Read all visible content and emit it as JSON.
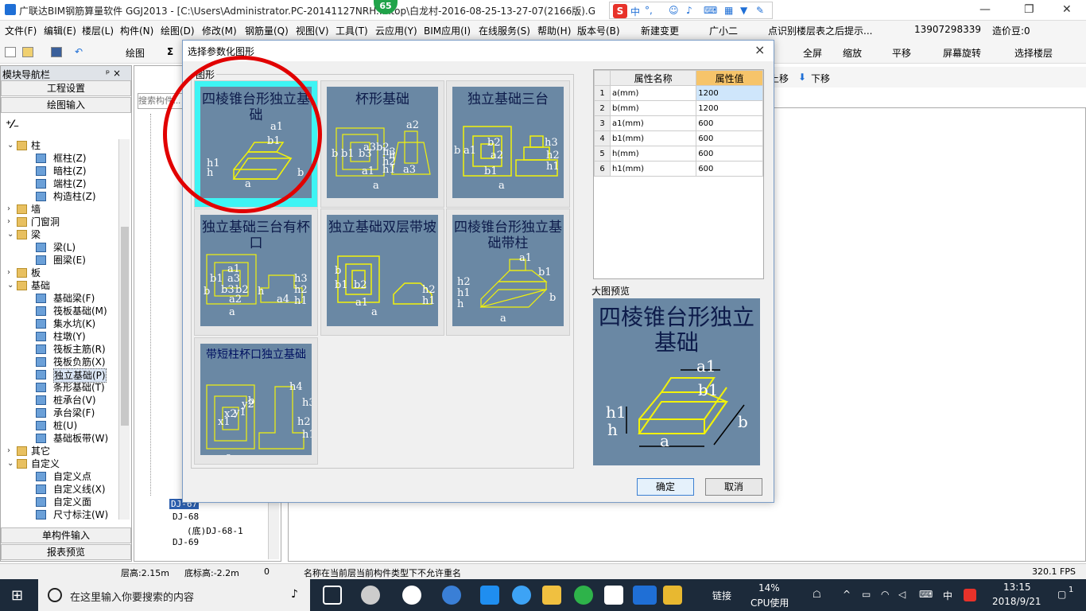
{
  "titlebar": {
    "badge": "65",
    "title": "广联达BIM钢筋算量软件 GGJ2013 - [C:\\Users\\Administrator.PC-20141127NRH...ktop\\白龙村-2016-08-25-13-27-07(2166版).G",
    "ime": {
      "lang": "中",
      "punct": "°,"
    }
  },
  "menubar": [
    "文件(F)",
    "编辑(E)",
    "楼层(L)",
    "构件(N)",
    "绘图(D)",
    "修改(M)",
    "钢筋量(Q)",
    "视图(V)",
    "工具(T)",
    "云应用(Y)",
    "BIM应用(I)",
    "在线服务(S)",
    "帮助(H)",
    "版本号(B)",
    "新建变更",
    "广小二",
    "点识别楼层表之后提示...",
    "13907298339",
    "造价豆:0"
  ],
  "toolbar": {
    "draw": "绘图",
    "sum": "Σ",
    "fullscreen": "全屏",
    "zoom": "缩放",
    "pan": "平移",
    "rotate": "屏幕旋转",
    "select_floor": "选择楼层",
    "new": "新建",
    "move_up": "上移",
    "move_down": "下移"
  },
  "left_panel": {
    "title": "模块导航栏",
    "pin": "ᵖ ×",
    "engineering_settings": "工程设置",
    "drawing_input": "绘图输入",
    "single_input": "单构件输入",
    "report_preview": "报表预览",
    "tree": [
      {
        "label": "柱",
        "level": 0,
        "type": "folder",
        "toggle": "⌄"
      },
      {
        "label": "框柱(Z)",
        "level": 1,
        "type": "comp"
      },
      {
        "label": "暗柱(Z)",
        "level": 1,
        "type": "comp"
      },
      {
        "label": "端柱(Z)",
        "level": 1,
        "type": "comp"
      },
      {
        "label": "构造柱(Z)",
        "level": 1,
        "type": "comp"
      },
      {
        "label": "墙",
        "level": 0,
        "type": "folder",
        "toggle": "›"
      },
      {
        "label": "门窗洞",
        "level": 0,
        "type": "folder",
        "toggle": "›"
      },
      {
        "label": "梁",
        "level": 0,
        "type": "folder",
        "toggle": "⌄"
      },
      {
        "label": "梁(L)",
        "level": 1,
        "type": "comp"
      },
      {
        "label": "圈梁(E)",
        "level": 1,
        "type": "comp"
      },
      {
        "label": "板",
        "level": 0,
        "type": "folder",
        "toggle": "›"
      },
      {
        "label": "基础",
        "level": 0,
        "type": "folder",
        "toggle": "⌄"
      },
      {
        "label": "基础梁(F)",
        "level": 1,
        "type": "comp"
      },
      {
        "label": "筏板基础(M)",
        "level": 1,
        "type": "comp"
      },
      {
        "label": "集水坑(K)",
        "level": 1,
        "type": "comp"
      },
      {
        "label": "柱墩(Y)",
        "level": 1,
        "type": "comp"
      },
      {
        "label": "筏板主筋(R)",
        "level": 1,
        "type": "comp"
      },
      {
        "label": "筏板负筋(X)",
        "level": 1,
        "type": "comp"
      },
      {
        "label": "独立基础(P)",
        "level": 1,
        "type": "comp",
        "selected": true
      },
      {
        "label": "条形基础(T)",
        "level": 1,
        "type": "comp"
      },
      {
        "label": "桩承台(V)",
        "level": 1,
        "type": "comp"
      },
      {
        "label": "承台梁(F)",
        "level": 1,
        "type": "comp"
      },
      {
        "label": "桩(U)",
        "level": 1,
        "type": "comp"
      },
      {
        "label": "基础板带(W)",
        "level": 1,
        "type": "comp"
      },
      {
        "label": "其它",
        "level": 0,
        "type": "folder",
        "toggle": "›"
      },
      {
        "label": "自定义",
        "level": 0,
        "type": "folder",
        "toggle": "⌄"
      },
      {
        "label": "自定义点",
        "level": 1,
        "type": "comp"
      },
      {
        "label": "自定义线(X)",
        "level": 1,
        "type": "comp"
      },
      {
        "label": "自定义面",
        "level": 1,
        "type": "comp"
      },
      {
        "label": "尺寸标注(W)",
        "level": 1,
        "type": "comp"
      }
    ]
  },
  "mid_panel": {
    "search_placeholder": "搜索构件...",
    "items": [
      "DJ-67",
      "DJ-68",
      "(底)DJ-68-1",
      "DJ-69"
    ]
  },
  "dialog": {
    "title": "选择参数化图形",
    "close": "×",
    "group_label": "图形",
    "shapes": [
      {
        "caption": "四棱锥台形独立基础",
        "dims": [
          "a1",
          "b1",
          "h1",
          "h",
          "a",
          "b"
        ],
        "selected": true
      },
      {
        "caption": "杯形基础",
        "dims": [
          "a2",
          "a3",
          "b3",
          "b2",
          "h3",
          "h2",
          "h1",
          "h",
          "a1",
          "a3",
          "b",
          "b1",
          "a"
        ]
      },
      {
        "caption": "独立基础三台",
        "dims": [
          "b2",
          "a2",
          "a1",
          "b1",
          "h3",
          "h2",
          "h1",
          "a",
          "b"
        ]
      },
      {
        "caption": "独立基础三台有杯口",
        "dims": [
          "a1",
          "a3",
          "b1",
          "b3",
          "b2",
          "a2",
          "h3",
          "h2",
          "h1",
          "a4",
          "a",
          "b",
          "h"
        ]
      },
      {
        "caption": "独立基础双层带坡",
        "dims": [
          "b1",
          "b2",
          "a1",
          "h2",
          "h1",
          "a",
          "b"
        ]
      },
      {
        "caption": "四棱锥台形独立基础带柱",
        "dims": [
          "a1",
          "b1",
          "h2",
          "h1",
          "h",
          "b",
          "a"
        ]
      },
      {
        "caption": "带短柱杯口独立基础",
        "dims": [
          "h4",
          "h3",
          "h2",
          "h1",
          "x1",
          "x2",
          "y1",
          "y2",
          "b",
          "a"
        ]
      }
    ],
    "properties": {
      "col_name": "属性名称",
      "col_value": "属性值",
      "rows": [
        {
          "idx": "1",
          "name": "a(mm)",
          "value": "1200"
        },
        {
          "idx": "2",
          "name": "b(mm)",
          "value": "1200"
        },
        {
          "idx": "3",
          "name": "a1(mm)",
          "value": "600"
        },
        {
          "idx": "4",
          "name": "b1(mm)",
          "value": "600"
        },
        {
          "idx": "5",
          "name": "h(mm)",
          "value": "600"
        },
        {
          "idx": "6",
          "name": "h1(mm)",
          "value": "600"
        }
      ]
    },
    "preview_label": "大图预览",
    "preview_caption": "四棱锥台形独立基础",
    "preview_dims": [
      "a1",
      "b1",
      "h1",
      "h",
      "a",
      "b"
    ],
    "ok": "确定",
    "cancel": "取消"
  },
  "statusbar": {
    "floor_height": "层高:2.15m",
    "bottom_elev": "底标高:-2.2m",
    "zero": "0",
    "message": "名称在当前层当前构件类型下不允许重名",
    "fps": "320.1 FPS"
  },
  "taskbar": {
    "search_placeholder": "在这里输入你要搜索的内容",
    "network": "链接",
    "cpu_percent": "14%",
    "cpu_label": "CPU使用",
    "lang": "中",
    "time": "13:15",
    "date": "2018/9/21",
    "notif": "1"
  },
  "colors": {
    "thumb_bg": "#6a88a4",
    "selected_bg": "#3ef4f4",
    "annotation_red": "#e10000",
    "value_header": "#f6c46a"
  }
}
